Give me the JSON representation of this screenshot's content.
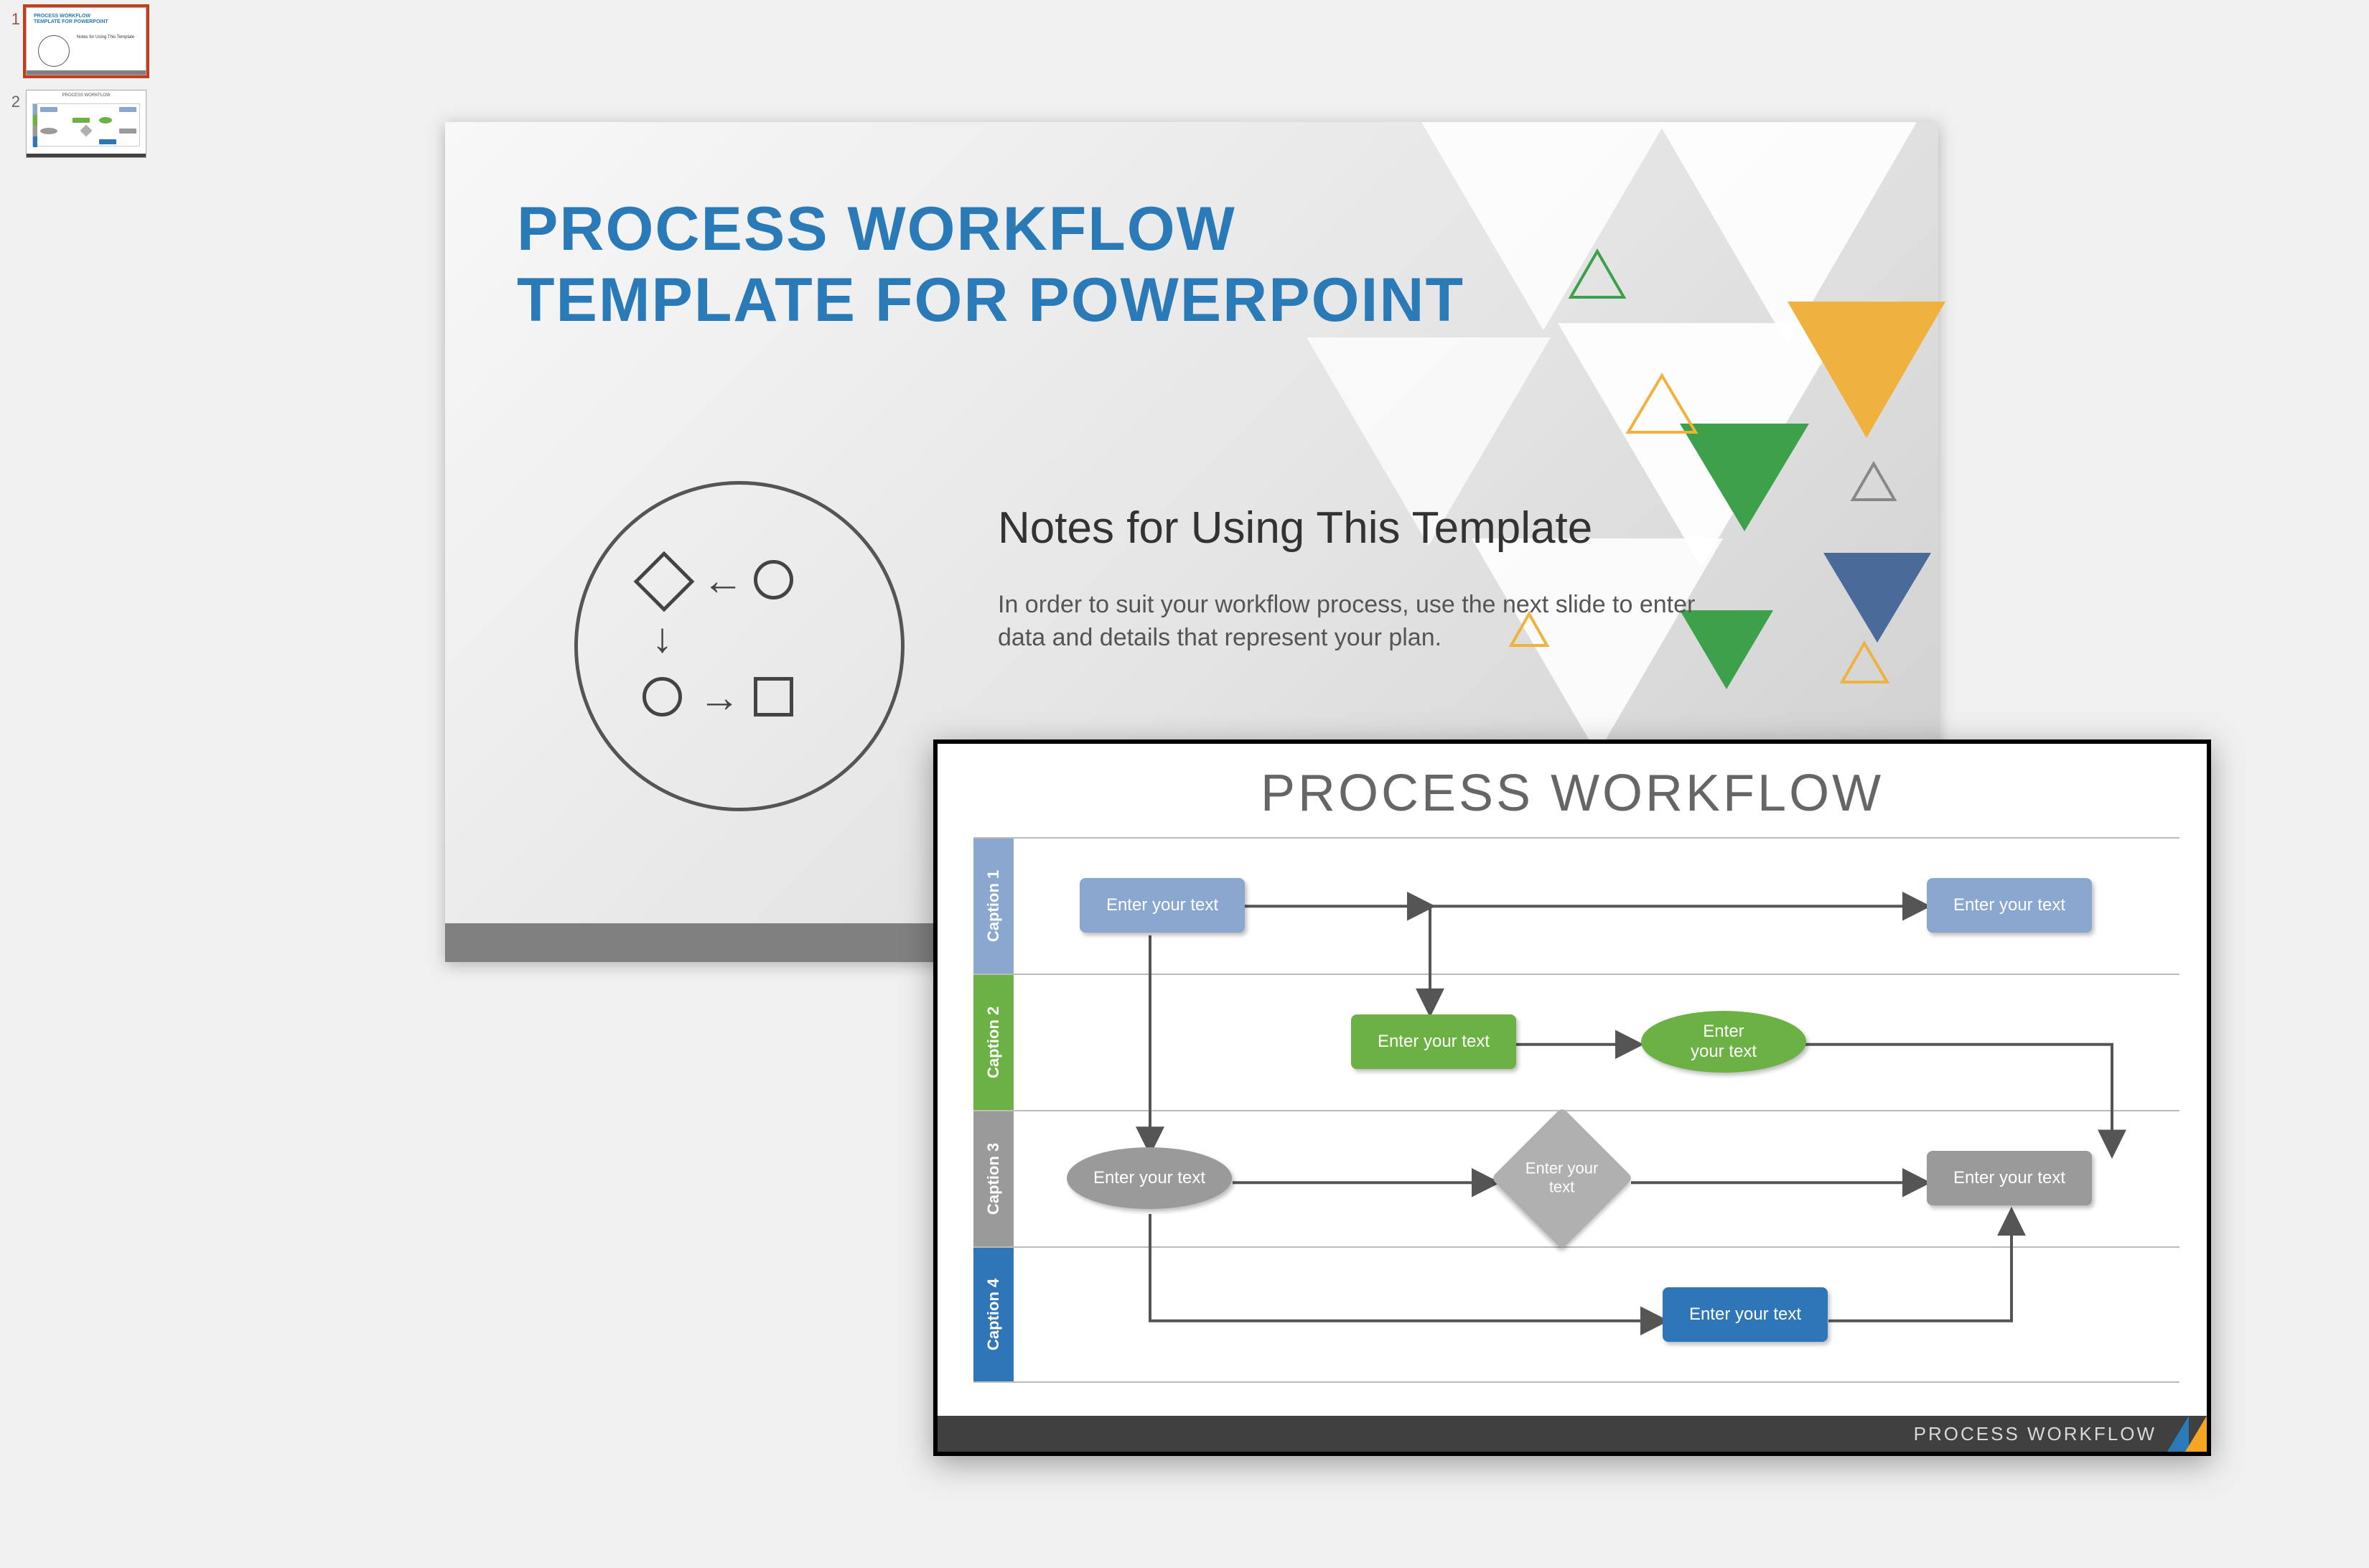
{
  "thumbnails": [
    {
      "num": "1",
      "title_l1": "PROCESS WORKFLOW",
      "title_l2": "TEMPLATE FOR POWERPOINT",
      "sub": "Notes for Using This Template"
    },
    {
      "num": "2",
      "title": "PROCESS WORKFLOW"
    }
  ],
  "slide": {
    "title_line1": "PROCESS WORKFLOW",
    "title_line2": "TEMPLATE FOR POWERPOINT",
    "subtitle": "Notes for Using This Template",
    "body": "In order to suit your workflow process, use the next slide to enter data and details that represent your plan."
  },
  "overlay": {
    "title": "PROCESS WORKFLOW",
    "footer": "PROCESS WORKFLOW",
    "lanes": [
      {
        "label": "Caption 1",
        "color": "#8aa7cf"
      },
      {
        "label": "Caption 2",
        "color": "#6bb143"
      },
      {
        "label": "Caption 3",
        "color": "#9a9a9a"
      },
      {
        "label": "Caption 4",
        "color": "#2f76b8"
      }
    ],
    "nodes": {
      "n1": "Enter your text",
      "n2": "Enter your text",
      "n3": "Enter your text",
      "n4": "Enter\nyour text",
      "n5": "Enter your text",
      "n6": "Enter your\ntext",
      "n7": "Enter your text",
      "n8": "Enter your text"
    },
    "colors": {
      "blue": "#8aa7cf",
      "green": "#6bb143",
      "gray": "#9a9a9a",
      "darkblue": "#2f76b8",
      "grayDiamond": "#b0b0b0"
    }
  }
}
